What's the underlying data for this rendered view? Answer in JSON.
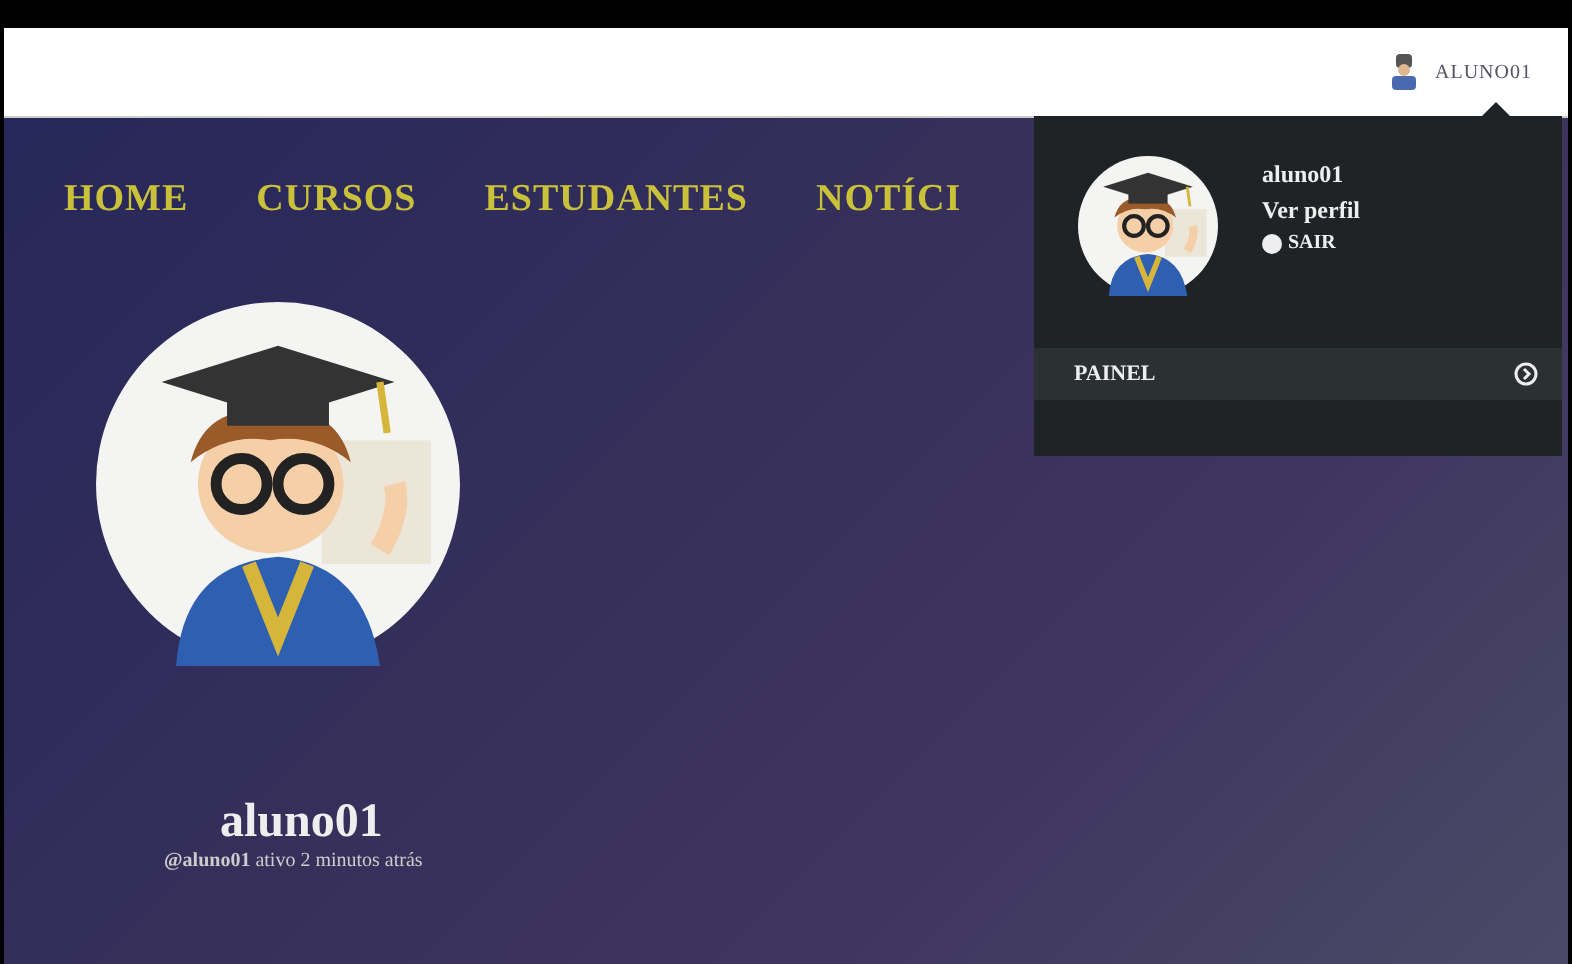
{
  "topbar": {
    "username": "ALUNO01"
  },
  "nav": {
    "items": [
      {
        "label": "HOME"
      },
      {
        "label": "CURSOS"
      },
      {
        "label": "ESTUDANTES"
      },
      {
        "label": "NOTÍCI"
      }
    ]
  },
  "profile": {
    "name": "aluno01",
    "status": "**@aluno01** ativo 2 minutos atrás"
  },
  "user_menu": {
    "name": "aluno01",
    "view_profile": "Ver perfil",
    "logout": "SAIR",
    "panel": "PAINEL"
  }
}
